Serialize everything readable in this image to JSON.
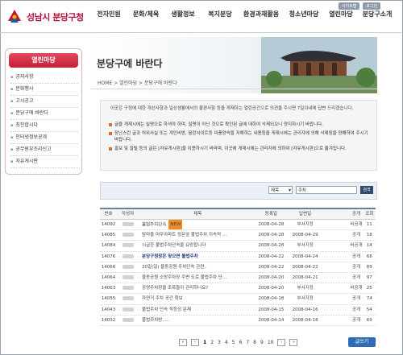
{
  "header": {
    "logo_text": "성남시 분당구청",
    "util_links": [
      "사이트맵",
      "로그인"
    ],
    "nav": [
      "전자민원",
      "문화/체육",
      "생활정보",
      "복지분당",
      "환경과재활용",
      "청소년마당",
      "열린마당",
      "분당구소개"
    ]
  },
  "sidebar": {
    "title": "열린마당",
    "items": [
      "공지사항",
      "문화행사",
      "고시공고",
      "분당구에 바란다",
      "칭찬합시다",
      "인터넷정보공개",
      "공무원부조리신고",
      "자유게시판"
    ]
  },
  "page": {
    "title": "분당구에 바란다",
    "breadcrumb": "HOME > 열린마당 > 분당구에 바란다"
  },
  "notice": {
    "intro_1": "이곳은 구정에 대한 개선사항과 일상생활에서의 불편사항 등을 게재하는 열린공간으로 의견을 주시면 7일이내에 답변 드리겠습니다.",
    "bullet_1": "글을 게재시에는 실명으로 하셔야 하며, 실명이 아닌 것으로 확인된 글에 대하여 삭제되오니 양지하시기 바랍니다.",
    "bullet_2": "장난스런 글과 허위사실 또는 개인비방, 음란사이트등 미풍양속을 저해하는 내용등을 게재시에는 관리자에 의해 삭제됨을 양해하여 주시기 바랍니다.",
    "bullet_3": "홍보 및 질릴 등의 글은 [자유게시판]을 이용하시기 바라며, 이곳에 게재시에는 관리자에 의하여 [자유게시판]으로 옮겨집니다."
  },
  "search": {
    "field_select": "제목",
    "query": "주차",
    "button": "검색"
  },
  "table": {
    "headers": [
      "번호",
      "작성자",
      "제목",
      "등록일",
      "답변일",
      "공개",
      "조회"
    ],
    "rows": [
      {
        "no": "14092",
        "title": "불법주차단속",
        "new": "NEW",
        "reg": "2008-04-28",
        "dept": "부서지정",
        "ans": "",
        "pub": "비공개",
        "views": "11"
      },
      {
        "no": "14085",
        "title": "탐마을 머우아파트 정문앞 불법주차 지속적 ...",
        "reg": "2008-04-28",
        "dept": "2008-04-29",
        "ans": "",
        "pub": "공개",
        "views": "18"
      },
      {
        "no": "14084",
        "title": "시급한 불법주차단속을 요망합니다",
        "reg": "2008-04-28",
        "dept": "부서지정",
        "ans": "",
        "pub": "비공개",
        "views": "14"
      },
      {
        "no": "14076",
        "title": "분당구청장은 맞으면 불법주차",
        "reg": "2008-04-22",
        "dept": "2008-04-24",
        "ans": "",
        "pub": "공개",
        "views": "68"
      },
      {
        "no": "14066",
        "title": "20일(일) 율동공원 주차단속 관련..",
        "reg": "2008-04-22",
        "dept": "2008-04-22",
        "ans": "",
        "pub": "공개",
        "views": "89"
      },
      {
        "no": "14064",
        "title": "율동공원 소방주차장 주변 도로 불법주차 단...",
        "reg": "2008-04-20",
        "dept": "2008-04-21",
        "ans": "",
        "pub": "공개",
        "views": "97"
      },
      {
        "no": "14063",
        "title": "공영주차장을 조폭들이 관리하나요?",
        "reg": "2008-04-20",
        "dept": "부서지정",
        "ans": "",
        "pub": "비공개",
        "views": "25"
      },
      {
        "no": "14055",
        "title": "자연거 주차 공간 확보",
        "reg": "2008-04-18",
        "dept": "부서지정",
        "ans": "",
        "pub": "공개",
        "views": "74"
      },
      {
        "no": "14043",
        "title": "불법주차 단속 적정성 문제",
        "reg": "2008-04-15",
        "dept": "2008-04-16",
        "ans": "",
        "pub": "공개",
        "views": "54"
      },
      {
        "no": "14032",
        "title": "불법주차방.....",
        "reg": "2008-04-14",
        "dept": "2008-04-18",
        "ans": "",
        "pub": "공개",
        "views": "69"
      }
    ]
  },
  "pagination": {
    "pages": [
      "1",
      "2",
      "3",
      "4",
      "5",
      "6",
      "7",
      "8",
      "9",
      "10"
    ],
    "current": "1",
    "write_button": "글쓰기"
  },
  "colors": {
    "brand": "#b0163d",
    "sidebar_title": "#c52037",
    "button": "#2f6cb5"
  }
}
